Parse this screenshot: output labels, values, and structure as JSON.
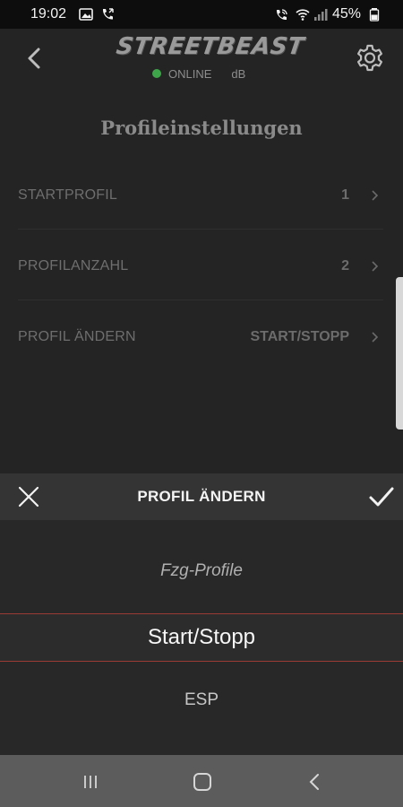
{
  "status_bar": {
    "time": "19:02",
    "battery_percent": "45%",
    "icons": [
      "gallery-icon",
      "call-icon",
      "wifi-call-icon",
      "wifi-icon",
      "signal-icon",
      "battery-icon"
    ]
  },
  "header": {
    "logo_text": "STREETBEAST",
    "connection_status": "ONLINE",
    "unit_label": "dB",
    "status_color": "#3fa54a"
  },
  "page": {
    "title": "Profileinstellungen"
  },
  "settings": [
    {
      "label": "STARTPROFIL",
      "value": "1"
    },
    {
      "label": "PROFILANZAHL",
      "value": "2"
    },
    {
      "label": "PROFIL ÄNDERN",
      "value": "START/STOPP"
    }
  ],
  "sheet": {
    "title": "PROFIL ÄNDERN",
    "options": [
      "Fzg-Profile",
      "Start/Stopp",
      "ESP"
    ],
    "selected": "Start/Stopp",
    "accent_color": "#9a3b36"
  },
  "nav_bar": {
    "buttons": [
      "recents-icon",
      "home-icon",
      "back-icon"
    ]
  }
}
